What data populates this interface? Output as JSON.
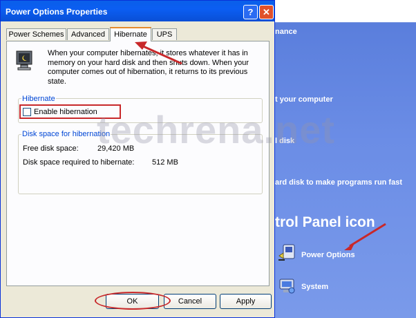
{
  "dialog": {
    "title": "Power Options Properties",
    "help_glyph": "?",
    "close_glyph": "✕",
    "tabs": [
      {
        "label": "Power Schemes"
      },
      {
        "label": "Advanced"
      },
      {
        "label": "Hibernate"
      },
      {
        "label": "UPS"
      }
    ],
    "description": "When your computer hibernates, it stores whatever it has in memory on your hard disk and then shuts down. When your computer comes out of hibernation, it returns to its previous state.",
    "hibernate_group": {
      "label": "Hibernate",
      "checkbox_label": "Enable hibernation"
    },
    "disk_group": {
      "label": "Disk space for hibernation",
      "free_label": "Free disk space:",
      "free_value": "29,420 MB",
      "required_label": "Disk space required to hibernate:",
      "required_value": "512 MB"
    },
    "buttons": {
      "ok": "OK",
      "cancel": "Cancel",
      "apply": "Apply"
    }
  },
  "background": {
    "heading": "nance",
    "tasks": [
      "t your computer",
      "l disk",
      "ard disk to make programs run fast"
    ],
    "control_panel": "trol Panel icon",
    "items": [
      {
        "label": "Power Options",
        "icon": "power-options-icon"
      },
      {
        "label": "System",
        "icon": "system-icon"
      }
    ],
    "watermark": "techrena.net"
  },
  "colors": {
    "title_bar": "#0a5fe9",
    "annotation_red": "#c8282a",
    "group_label_blue": "#0046d5",
    "control_panel_blue": "#6b8de6"
  }
}
